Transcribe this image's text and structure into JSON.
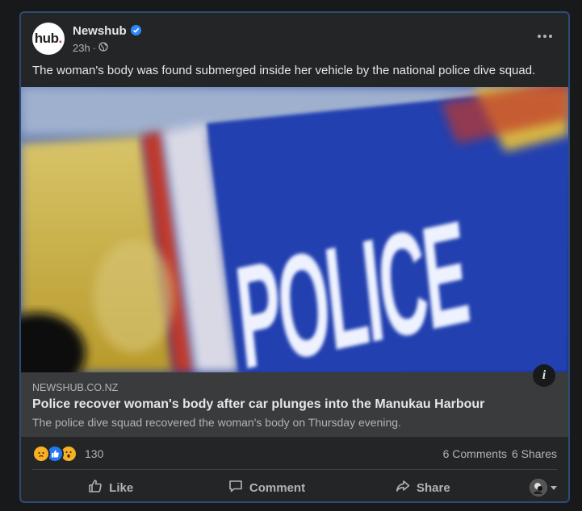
{
  "post": {
    "page_name": "Newshub",
    "avatar_text": "hub",
    "avatar_dot": ".",
    "time": "23h",
    "privacy_separator": "·",
    "caption": "The woman's body was found submerged inside her vehicle by the national police dive squad.",
    "image_text": "POLICE"
  },
  "link": {
    "domain": "NEWSHUB.CO.NZ",
    "title": "Police recover woman's body after car plunges into the Manukau Harbour",
    "description": "The police dive squad recovered the woman's body on Thursday evening.",
    "info_label": "i"
  },
  "stats": {
    "reaction_icons": [
      "sad-icon",
      "like-icon",
      "wow-icon"
    ],
    "reaction_count": "130",
    "comments": "6 Comments",
    "shares": "6 Shares"
  },
  "actions": {
    "like": "Like",
    "comment": "Comment",
    "share": "Share"
  },
  "colors": {
    "card_border": "#2d4a75",
    "card_bg": "#242526",
    "verified": "#2d88ff",
    "like_blue": "#2078f4",
    "reaction_yellow": "#f7b125"
  }
}
